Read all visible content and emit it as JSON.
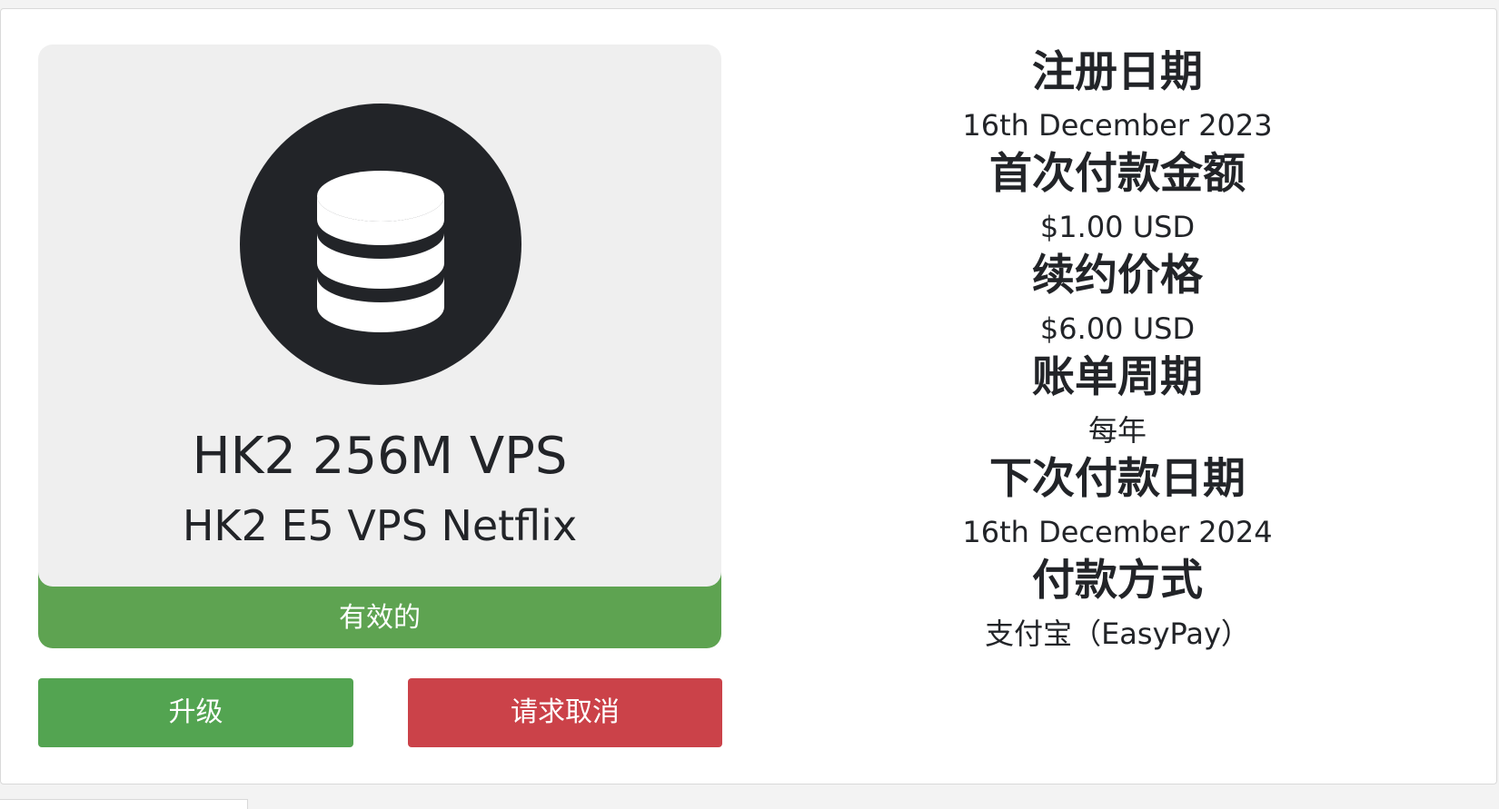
{
  "product": {
    "icon": "database-icon",
    "name": "HK2 256M VPS",
    "group": "HK2 E5 VPS Netflix",
    "status": "有效的"
  },
  "actions": {
    "upgrade_label": "升级",
    "cancel_label": "请求取消"
  },
  "details": {
    "registration_date_label": "注册日期",
    "registration_date": "16th December 2023",
    "first_payment_label": "首次付款金额",
    "first_payment": "$1.00 USD",
    "renewal_price_label": "续约价格",
    "renewal_price": "$6.00 USD",
    "billing_cycle_label": "账单周期",
    "billing_cycle": "每年",
    "next_due_label": "下次付款日期",
    "next_due": "16th December 2024",
    "payment_method_label": "付款方式",
    "payment_method": "支付宝（EasyPay）"
  },
  "colors": {
    "status_active": "#5ea351",
    "upgrade_button": "#53a451",
    "cancel_button": "#cb4249",
    "icon_circle": "#222428",
    "card_background": "#efefef"
  }
}
